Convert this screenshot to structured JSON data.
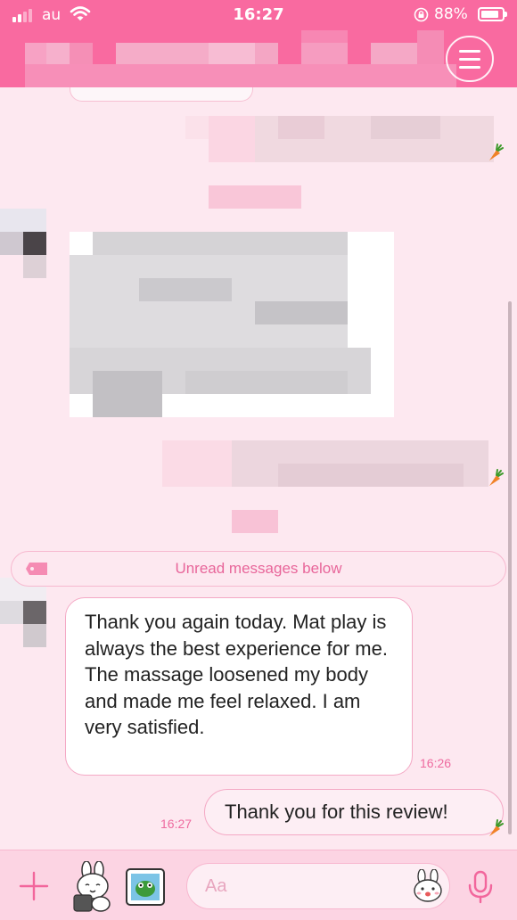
{
  "status_bar": {
    "carrier": "au",
    "time": "16:27",
    "battery_percent": "88%",
    "battery_level": 0.88,
    "signal_bars_active": 2,
    "signal_bars_total": 4,
    "icons": [
      "signal-icon",
      "wifi-icon",
      "orientation-lock-icon",
      "battery-icon"
    ]
  },
  "header": {
    "title_redacted": true,
    "menu_icon": "hamburger-menu-icon"
  },
  "chat": {
    "unread_divider": "Unread messages below",
    "messages": [
      {
        "direction": "incoming",
        "text": "Thank you again today. Mat play is always the best experience for me. The massage loosened my body and made me feel relaxed. I am very satisfied.",
        "time": "16:26"
      },
      {
        "direction": "outgoing",
        "text": "Thank you for this review!",
        "time": "16:27"
      }
    ]
  },
  "input_bar": {
    "placeholder": "Aa",
    "icons": [
      "plus-icon",
      "sticker-icon",
      "photo-icon",
      "emoji-icon",
      "microphone-icon"
    ]
  },
  "colors": {
    "theme_pink": "#f96aa0",
    "chat_background": "#fde8f0",
    "accent_text": "#ee6a9f",
    "bubble_border": "#f4a9c5"
  }
}
